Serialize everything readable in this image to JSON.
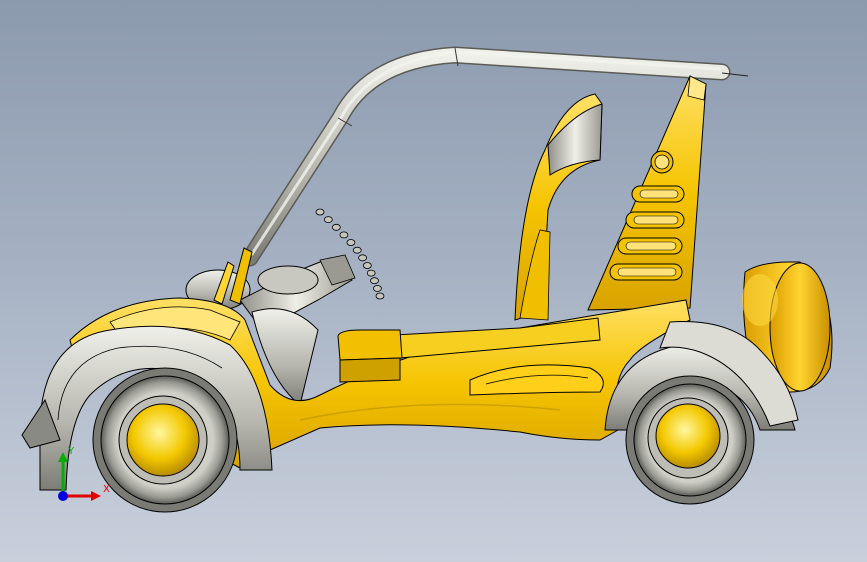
{
  "viewport": {
    "background_top": "#8c9aae",
    "background_bottom": "#c9d0dc"
  },
  "model": {
    "body_color": "#f5c400",
    "body_highlight": "#ffe066",
    "body_shade": "#c99400",
    "metal_color": "#b8b8b0",
    "metal_highlight": "#ececE6",
    "tire_color": "#3a3a3a",
    "edge_color": "#000000"
  },
  "triad": {
    "x_label": "X",
    "y_label": "Y",
    "x_color": "#e00000",
    "y_color": "#00b000",
    "z_color": "#0000e0"
  }
}
